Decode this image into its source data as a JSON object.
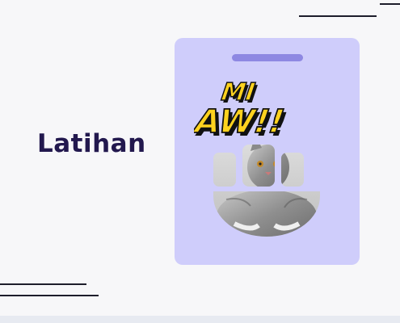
{
  "heading": "Latihan",
  "sticker": {
    "line1": "MI",
    "line2": "AW!!"
  },
  "colors": {
    "background": "#f7f7f9",
    "heading": "#22184e",
    "card": "#cfcdfb",
    "pill": "#8e88e2",
    "sticker_fill": "#ffd21f",
    "sticker_outline": "#111111"
  },
  "icons": [
    "cat-photo",
    "sticker-text"
  ]
}
